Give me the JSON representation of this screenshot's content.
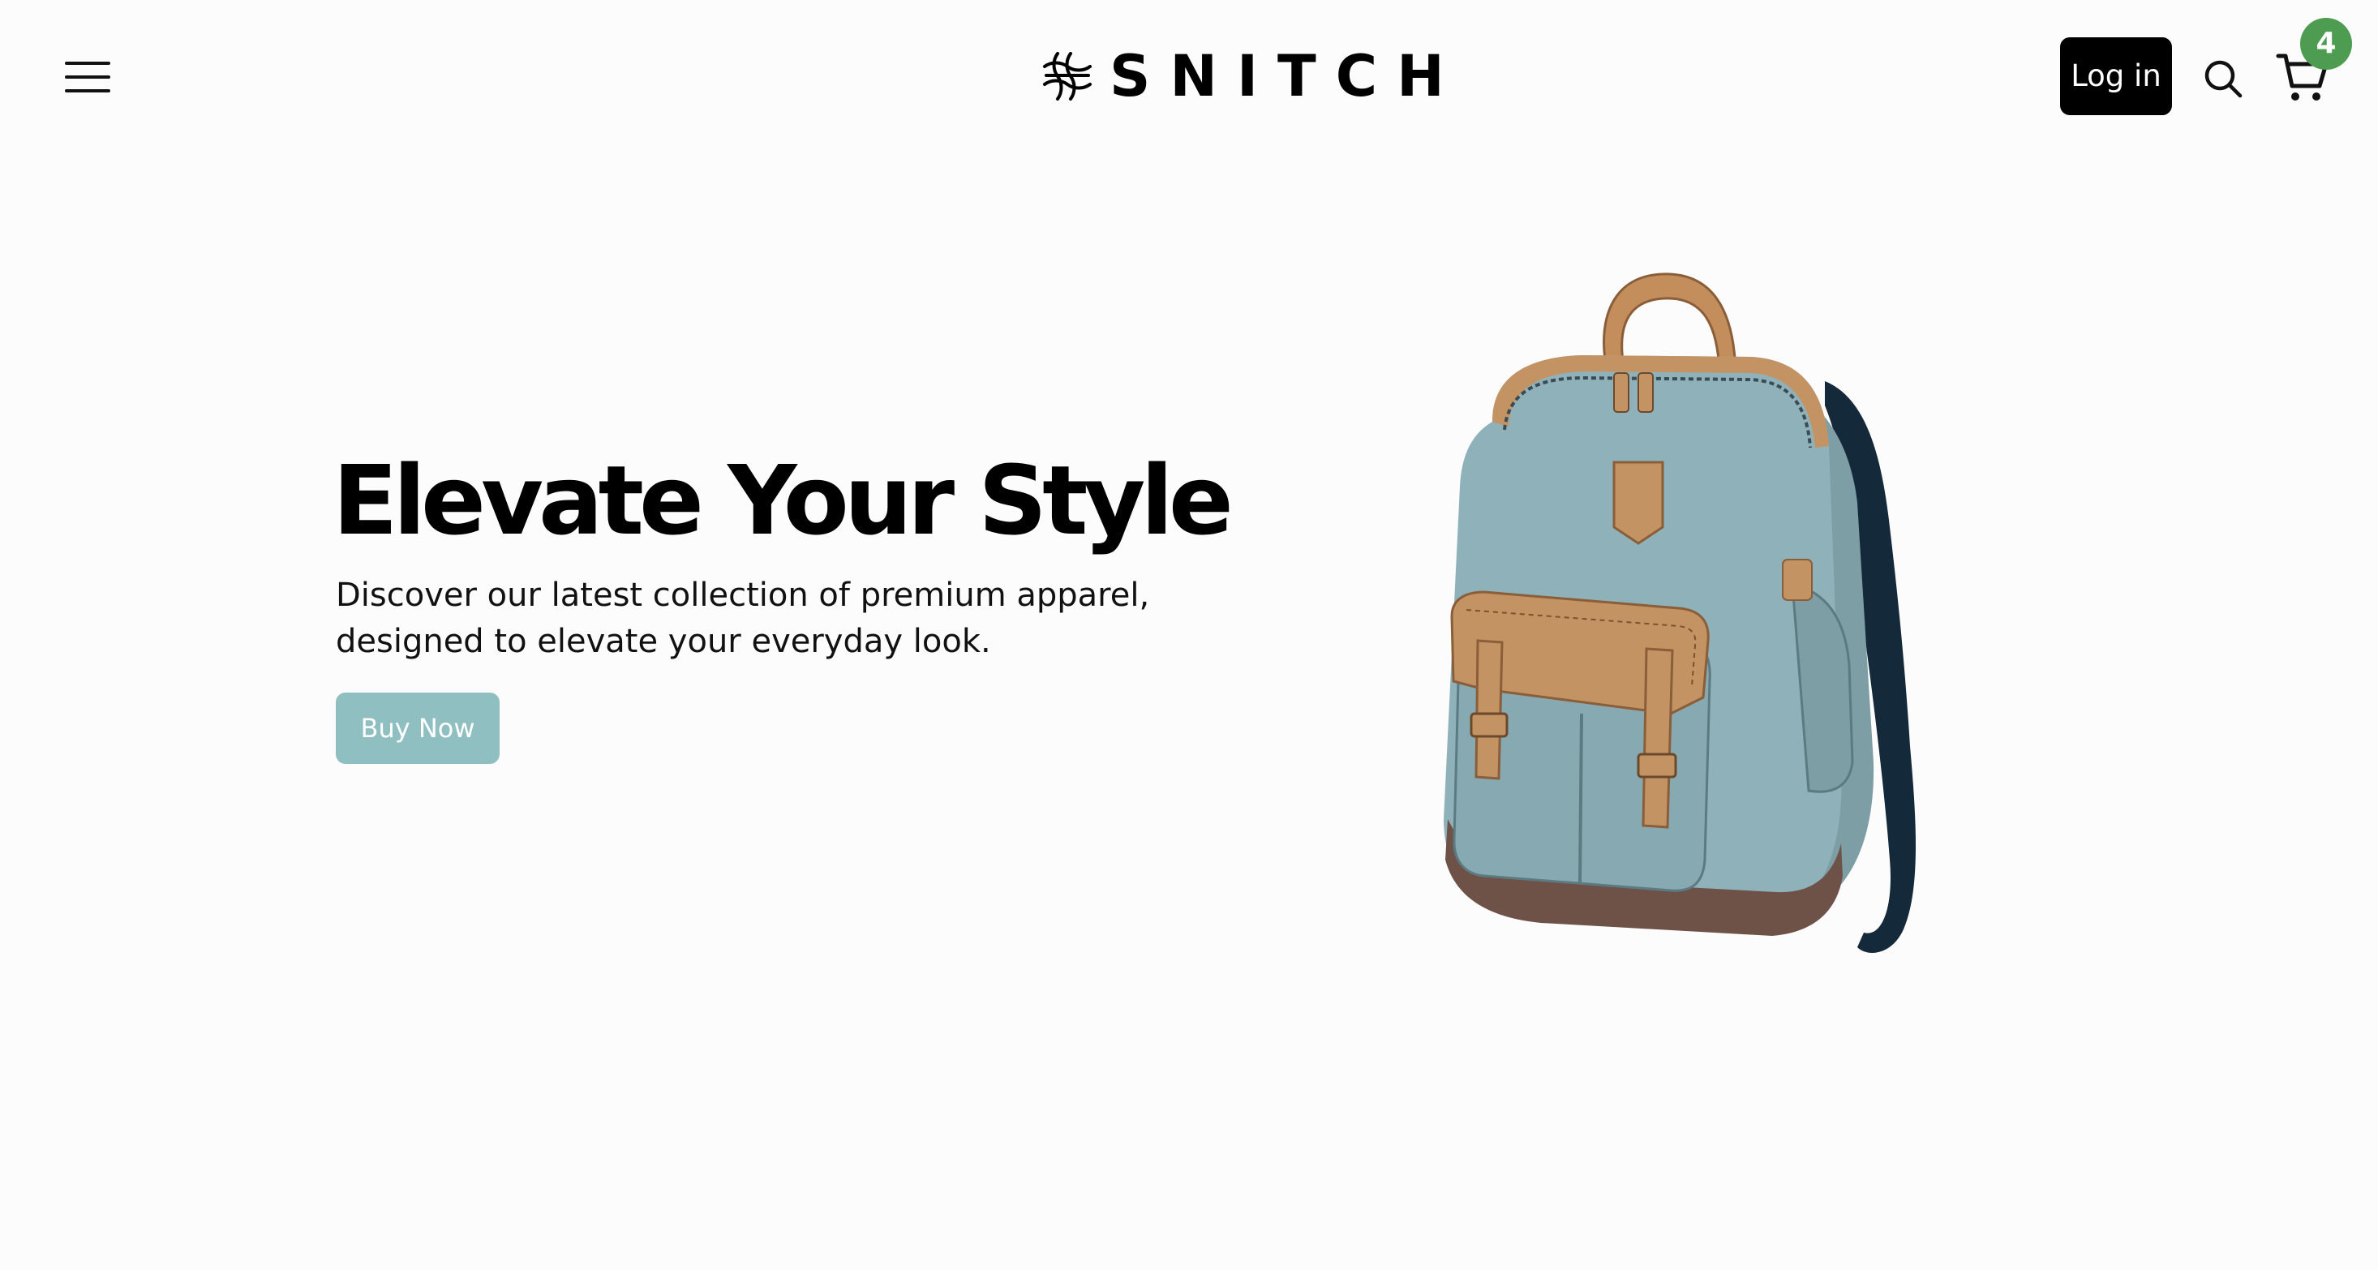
{
  "header": {
    "brand": "SNITCH",
    "login_label": "Log in",
    "cart_count": "4",
    "icons": {
      "menu": "hamburger-menu-icon",
      "logo": "snitch-logo-mark",
      "search": "search-icon",
      "cart": "shopping-cart-icon"
    }
  },
  "hero": {
    "title": "Elevate Your Style",
    "subtitle": "Discover our latest collection of premium apparel, designed to elevate your everyday look.",
    "cta_label": "Buy Now",
    "product": "backpack"
  },
  "colors": {
    "background": "#fdfcfc",
    "login_bg": "#000000",
    "cta_bg": "#8fbfc0",
    "badge_bg": "#4e9c52",
    "bag_body": "#8eb0b8",
    "bag_leather": "#c49364",
    "bag_base": "#6e5248"
  }
}
